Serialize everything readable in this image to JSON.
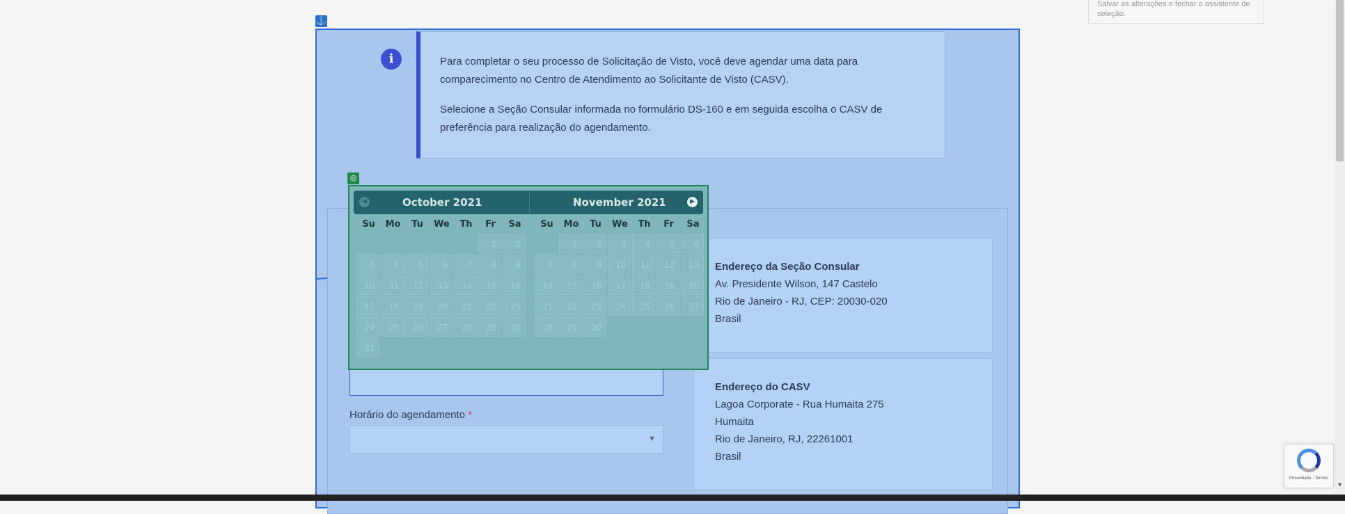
{
  "top_note": "Salvar as alterações e fechar o assistente de seleção.",
  "info": {
    "paragraph1": "Para completar o seu processo de Solicitação de Visto, você deve agendar uma data para comparecimento no Centro de Atendimento ao Solicitante de Visto (CASV).",
    "paragraph2": "Selecione a Seção Consular informada no formulário DS-160 e em seguida escolha o CASV de preferência para realização do agendamento.",
    "icon": "info-icon"
  },
  "datepicker": {
    "weekday_labels": [
      "Su",
      "Mo",
      "Tu",
      "We",
      "Th",
      "Fr",
      "Sa"
    ],
    "month1": {
      "label": "October 2021"
    },
    "month2": {
      "label": "November 2021"
    },
    "prev_icon": "chevron-left-icon",
    "next_icon": "chevron-right-icon"
  },
  "form": {
    "time_label": "Horário do agendamento",
    "required_mark": "*",
    "time_value": ""
  },
  "consular_address": {
    "title": "Endereço da Seção Consular",
    "line1": "Av. Presidente Wilson, 147 Castelo",
    "line2": "Rio de Janeiro - RJ, CEP: 20030-020",
    "line3": "Brasil"
  },
  "casv_address": {
    "title": "Endereço do CASV",
    "line1": "Lagoa Corporate - Rua Humaita 275",
    "line2": "Humaita",
    "line3": "Rio de Janeiro, RJ, 22261001",
    "line4": "Brasil"
  },
  "recaptcha": {
    "text": "Privacidade - Termos"
  },
  "colors": {
    "overlay_blue": "#a9c7ee",
    "picker_teal": "#7fb6b9",
    "info_accent": "#3a4fd0"
  }
}
